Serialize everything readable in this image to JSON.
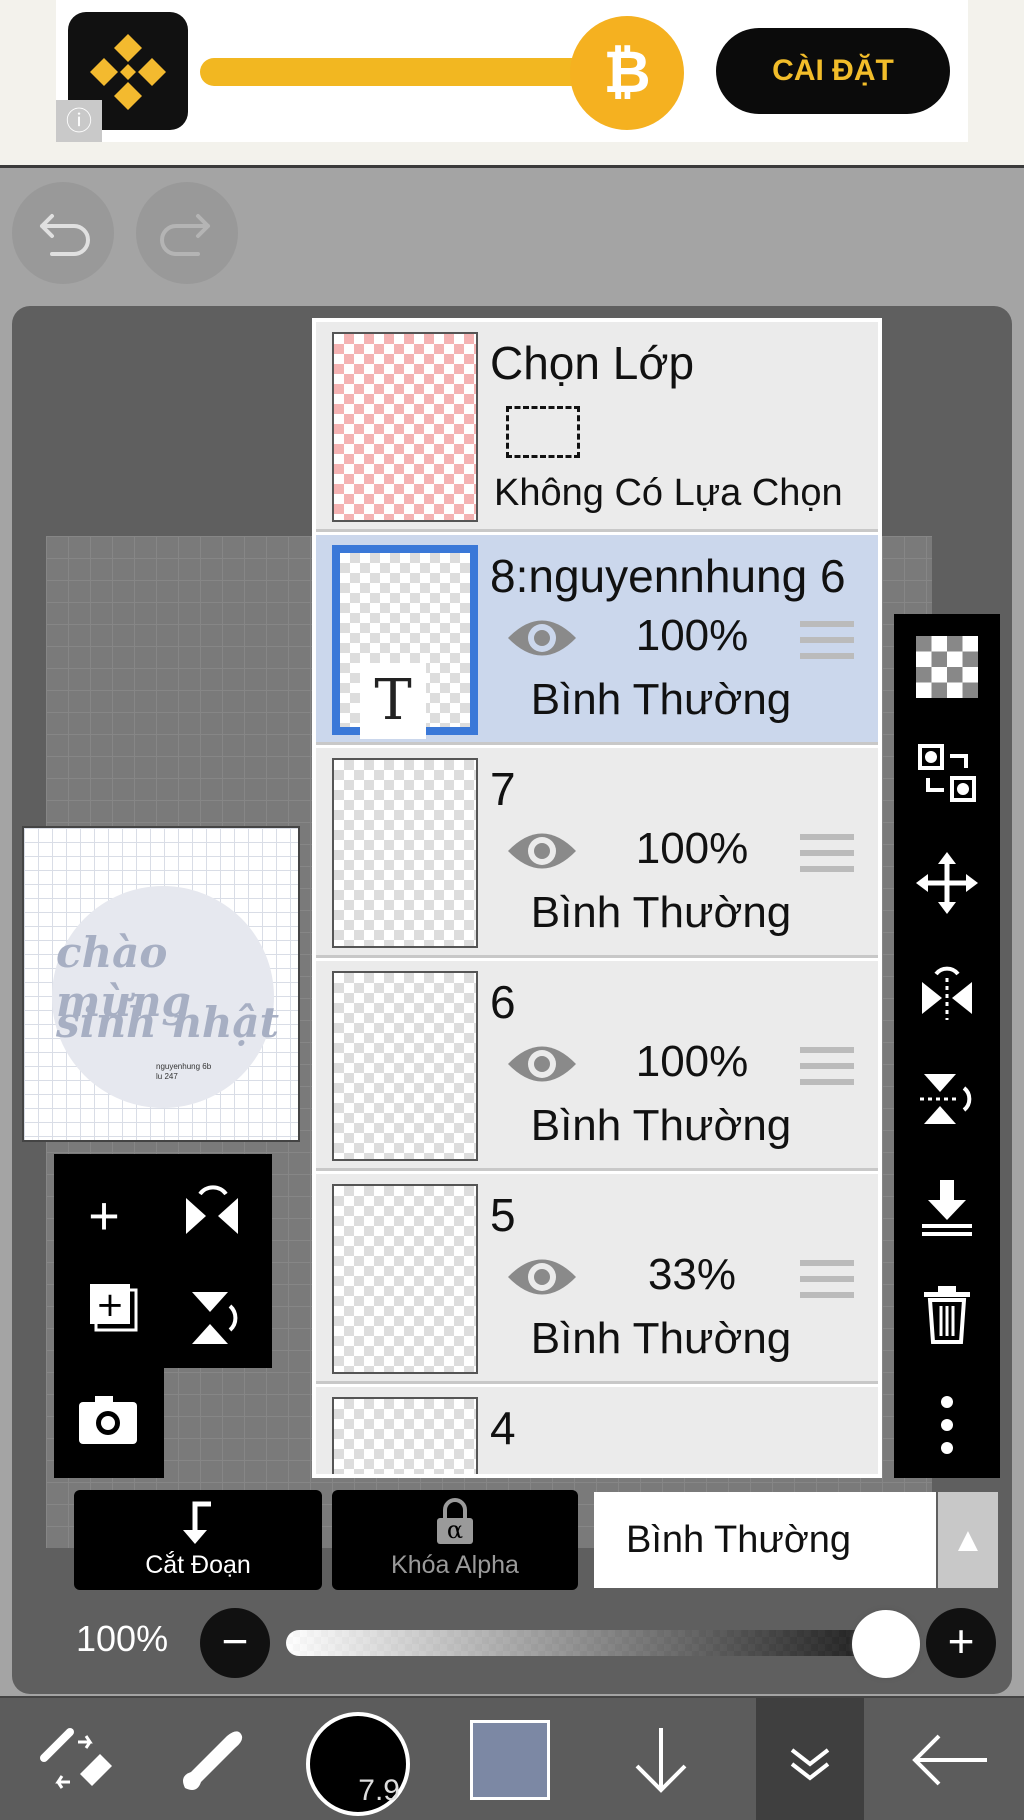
{
  "ad": {
    "install_label": "CÀI ĐẶT",
    "coin_symbol": "₿",
    "info_symbol": "ⓘ",
    "brand_color": "#f3ba2f"
  },
  "toolbar": {
    "undo_icon": "undo-icon",
    "redo_icon": "redo-icon"
  },
  "preview": {
    "line1": "chào mừng",
    "line2": "sinh nhật",
    "caption_line1": "nguyenhung 6b",
    "caption_line2": "lu 247"
  },
  "layers_panel": {
    "selection_layer": {
      "title": "Chọn Lớp",
      "status": "Không Có Lựa Chọn"
    },
    "layers": [
      {
        "name": "8:nguyennhung 6",
        "opacity": "100%",
        "blend": "Bình Thường",
        "selected": true,
        "is_text": true,
        "text_badge": "T"
      },
      {
        "name": "7",
        "opacity": "100%",
        "blend": "Bình Thường",
        "selected": false
      },
      {
        "name": "6",
        "opacity": "100%",
        "blend": "Bình Thường",
        "selected": false
      },
      {
        "name": "5",
        "opacity": "33%",
        "blend": "Bình Thường",
        "selected": false
      },
      {
        "name": "4",
        "opacity": "",
        "blend": "",
        "selected": false
      }
    ]
  },
  "layer_controls": {
    "clipping_label": "Cắt Đoạn",
    "alpha_lock_label": "Khóa Alpha",
    "alpha_symbol": "α",
    "blend_mode": "Bình Thường",
    "opacity_label": "100%",
    "opacity_value": 1.0
  },
  "bottom_bar": {
    "brush_size": "7.9",
    "color": "#7c88a4"
  },
  "colors": {
    "selection_highlight": "#3a78d8",
    "selected_row": "#cbd7ec"
  }
}
